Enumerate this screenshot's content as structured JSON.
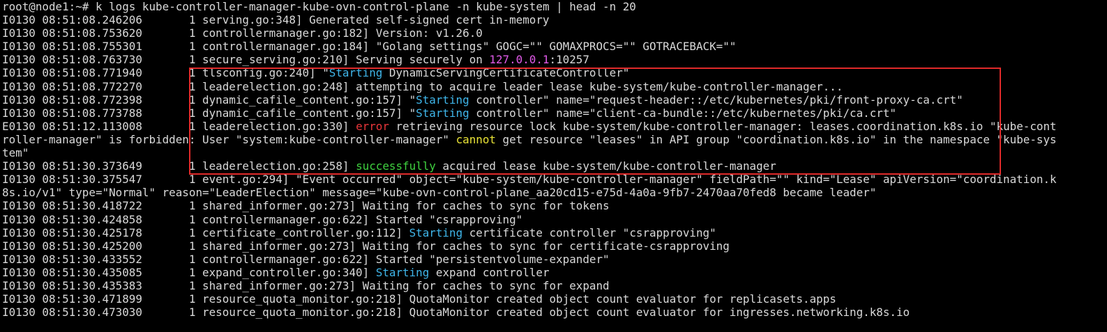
{
  "terminal": {
    "prompt": "root@node1:~# ",
    "command": "k logs kube-controller-manager-kube-ovn-control-plane -n kube-system | head -n 20",
    "lines": [
      [
        {
          "t": "I0130 08:51:08.246206       1 serving.go:348] Generated self-signed cert in-memory"
        }
      ],
      [
        {
          "t": "I0130 08:51:08.753620       1 controllermanager.go:182] Version: v1.26.0"
        }
      ],
      [
        {
          "t": "I0130 08:51:08.755301       1 controllermanager.go:184] \"Golang settings\" GOGC=\"\" GOMAXPROCS=\"\" GOTRACEBACK=\"\""
        }
      ],
      [
        {
          "t": "I0130 08:51:08.763730       1 secure_serving.go:210] Serving securely on "
        },
        {
          "t": "127.0.0.1",
          "c": "magenta"
        },
        {
          "t": ":10257"
        }
      ],
      [
        {
          "t": "I0130 08:51:08.771940       1 tlsconfig.go:240] \""
        },
        {
          "t": "Starting",
          "c": "cyan"
        },
        {
          "t": " DynamicServingCertificateController\""
        }
      ],
      [
        {
          "t": "I0130 08:51:08.772270       1 leaderelection.go:248] attempting to acquire leader lease kube-system/kube-controller-manager..."
        }
      ],
      [
        {
          "t": "I0130 08:51:08.772398       1 dynamic_cafile_content.go:157] \""
        },
        {
          "t": "Starting",
          "c": "cyan"
        },
        {
          "t": " controller\" name=\"request-header::/etc/kubernetes/pki/front-proxy-ca.crt\""
        }
      ],
      [
        {
          "t": "I0130 08:51:08.773788       1 dynamic_cafile_content.go:157] \""
        },
        {
          "t": "Starting",
          "c": "cyan"
        },
        {
          "t": " controller\" name=\"client-ca-bundle::/etc/kubernetes/pki/ca.crt\""
        }
      ],
      [
        {
          "t": "E0130 08:51:12.113008       1 leaderelection.go:330] "
        },
        {
          "t": "error",
          "c": "red"
        },
        {
          "t": " retrieving resource lock kube-system/kube-controller-manager: leases.coordination.k8s.io \"kube-cont"
        }
      ],
      [
        {
          "t": "roller-manager\" is forbidden: User \"system:kube-controller-manager\" "
        },
        {
          "t": "cannot",
          "c": "yellow"
        },
        {
          "t": " get resource \"leases\" in API group \"coordination.k8s.io\" in the namespace \"kube-sys"
        }
      ],
      [
        {
          "t": "tem\""
        }
      ],
      [
        {
          "t": "I0130 08:51:30.373649       1 leaderelection.go:258] "
        },
        {
          "t": "successfully",
          "c": "green"
        },
        {
          "t": " acquired lease kube-system/kube-controller-manager"
        }
      ],
      [
        {
          "t": "I0130 08:51:30.375547       1 event.go:294] \"Event occurred\" object=\"kube-system/kube-controller-manager\" fieldPath=\"\" kind=\"Lease\" apiVersion=\"coordination.k"
        }
      ],
      [
        {
          "t": "8s.io/v1\" type=\"Normal\" reason=\"LeaderElection\" message=\"kube-ovn-control-plane_aa20cd15-e75d-4a0a-9fb7-2470aa70fed8 became leader\""
        }
      ],
      [
        {
          "t": "I0130 08:51:30.418722       1 shared_informer.go:273] Waiting for caches to sync for tokens"
        }
      ],
      [
        {
          "t": "I0130 08:51:30.424858       1 controllermanager.go:622] Started \"csrapproving\""
        }
      ],
      [
        {
          "t": "I0130 08:51:30.425178       1 certificate_controller.go:112] "
        },
        {
          "t": "Starting",
          "c": "cyan"
        },
        {
          "t": " certificate controller \"csrapproving\""
        }
      ],
      [
        {
          "t": "I0130 08:51:30.425200       1 shared_informer.go:273] Waiting for caches to sync for certificate-csrapproving"
        }
      ],
      [
        {
          "t": "I0130 08:51:30.433552       1 controllermanager.go:622] Started \"persistentvolume-expander\""
        }
      ],
      [
        {
          "t": "I0130 08:51:30.435085       1 expand_controller.go:340] "
        },
        {
          "t": "Starting",
          "c": "cyan"
        },
        {
          "t": " expand controller"
        }
      ],
      [
        {
          "t": "I0130 08:51:30.435383       1 shared_informer.go:273] Waiting for caches to sync for expand"
        }
      ],
      [
        {
          "t": "I0130 08:51:30.471899       1 resource_quota_monitor.go:218] QuotaMonitor created object count evaluator for replicasets.apps"
        }
      ],
      [
        {
          "t": "I0130 08:51:30.473030       1 resource_quota_monitor.go:218] QuotaMonitor created object count evaluator for ingresses.networking.k8s.io"
        }
      ]
    ]
  },
  "colors": {
    "background": "#000000",
    "foreground": "#d9d9d9",
    "cyan": "#3fb6ea",
    "magenta": "#e05ae8",
    "red": "#e8363a",
    "green": "#3fd13f",
    "yellow": "#e8e236",
    "highlight_box": "#e02a2a"
  }
}
